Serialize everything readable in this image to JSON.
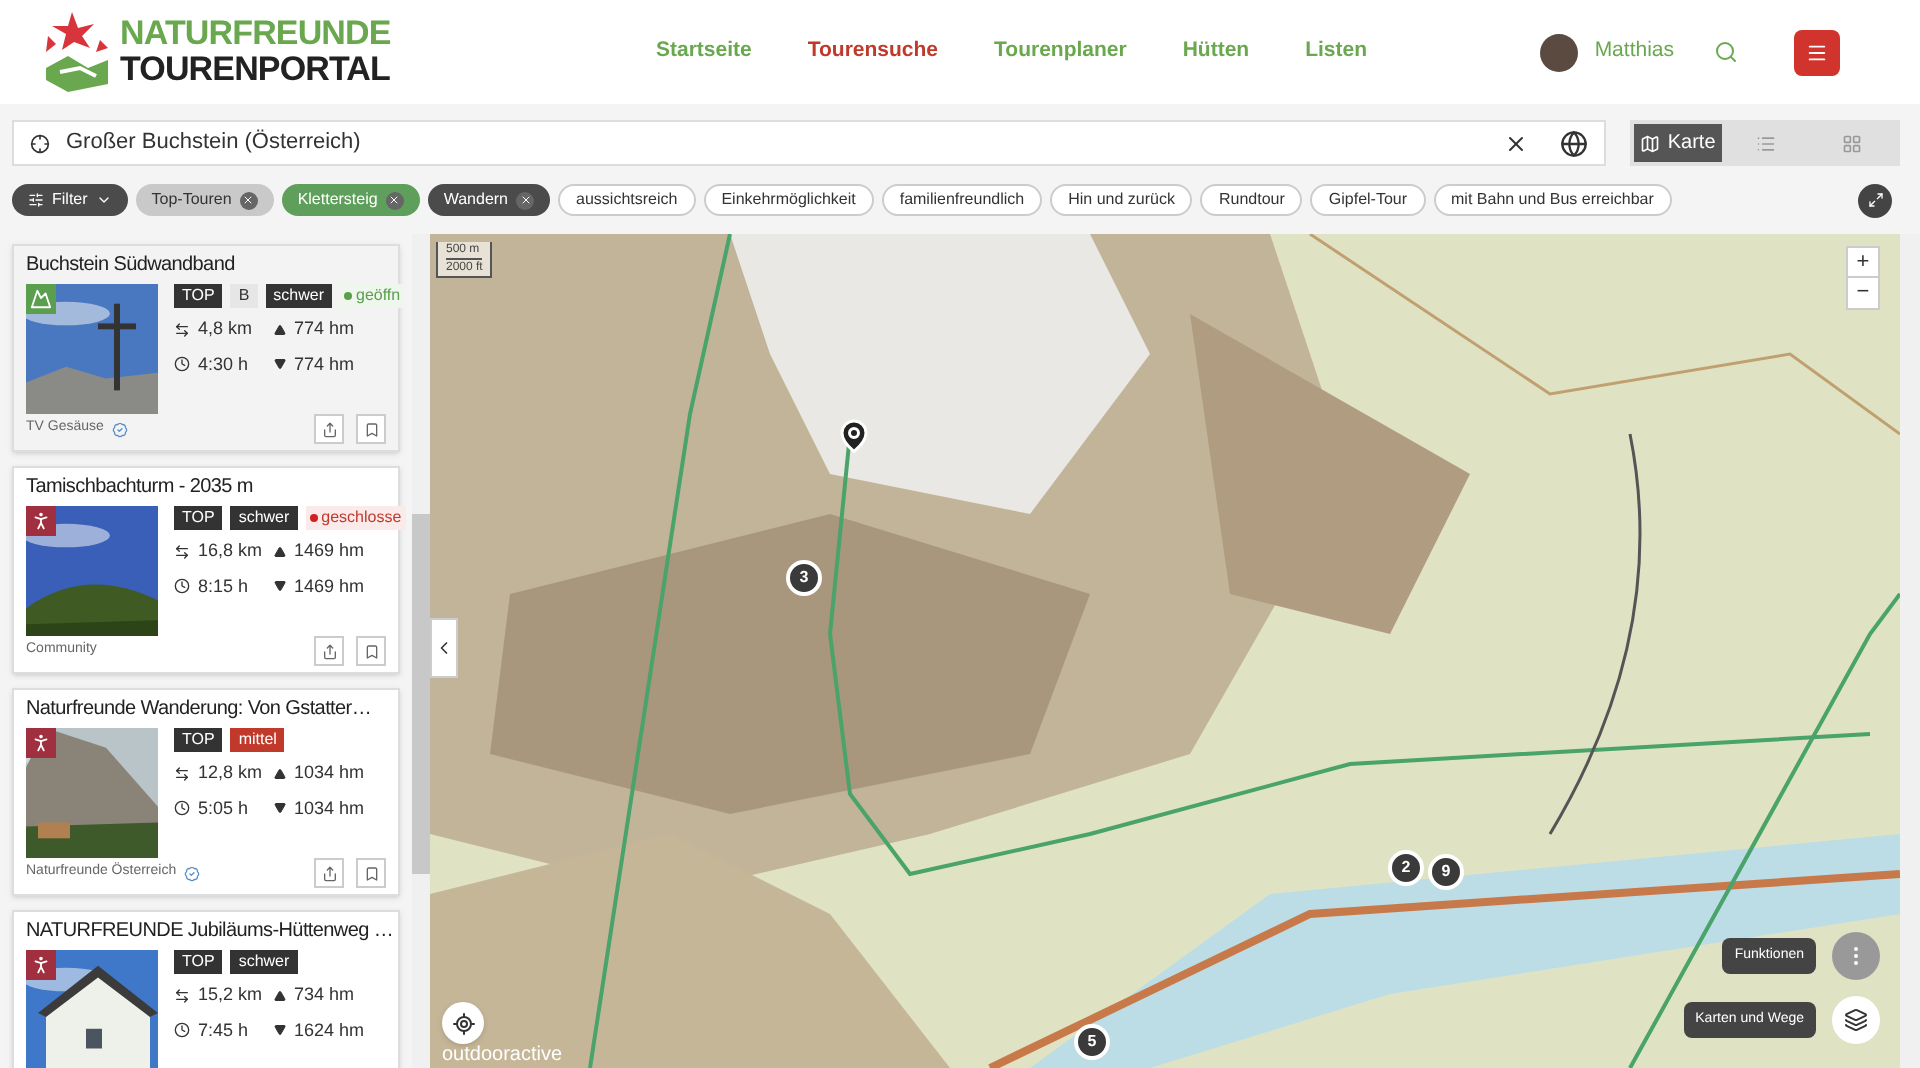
{
  "header": {
    "logo_line_1": "NATURFREUNDE",
    "logo_line_2": "TOURENPORTAL",
    "nav": [
      {
        "label": "Startseite",
        "selected": false
      },
      {
        "label": "Tourensuche",
        "selected": true
      },
      {
        "label": "Tourenplaner",
        "selected": false
      },
      {
        "label": "Hütten",
        "selected": false
      },
      {
        "label": "Listen",
        "selected": false
      }
    ],
    "user": "Matthias"
  },
  "search": {
    "value": "Großer Buchstein (Österreich)"
  },
  "view_toggle": [
    {
      "label": "Karte",
      "kind": "map",
      "selected": true
    },
    {
      "kind": "list",
      "selected": false
    },
    {
      "kind": "grid",
      "selected": false
    }
  ],
  "filters": [
    {
      "label": "Filter",
      "kind": "menu",
      "selected": true,
      "color": "#4b4b4b"
    },
    {
      "label": "Top-Touren",
      "kind": "tag",
      "selected": true,
      "color": "#c9c9c9"
    },
    {
      "label": "Klettersteig",
      "kind": "tag",
      "selected": true,
      "color": "#5f9f5c"
    },
    {
      "label": "Wandern",
      "kind": "tag",
      "selected": true,
      "color": "#4b4b4b"
    },
    {
      "label": "aussichtsreich",
      "kind": "tag",
      "selected": false
    },
    {
      "label": "Einkehrmöglichkeit",
      "kind": "tag",
      "selected": false
    },
    {
      "label": "familienfreundlich",
      "kind": "tag",
      "selected": false
    },
    {
      "label": "Hin und zurück",
      "kind": "tag",
      "selected": false
    },
    {
      "label": "Rundtour",
      "kind": "tag",
      "selected": false
    },
    {
      "label": "Gipfel-Tour",
      "kind": "tag",
      "selected": false
    },
    {
      "label": "mit Bahn und Bus erreichbar",
      "kind": "tag",
      "selected": false
    }
  ],
  "tours": [
    {
      "title": "Buchstein Südwandband",
      "kind": "climbing",
      "selected": true,
      "badges": [
        {
          "text": "TOP",
          "kind": "top"
        },
        {
          "text": "B",
          "kind": "grade"
        },
        {
          "text": "schwer",
          "kind": "hard"
        }
      ],
      "status": {
        "text": "geöffn",
        "kind": "open"
      },
      "distance": "4,8 km",
      "duration": "4:30 h",
      "ascent": "774 hm",
      "descent": "774 hm",
      "source": "TV Gesäuse",
      "verified": true
    },
    {
      "title": "Tamischbachturm - 2035 m",
      "kind": "hiking",
      "selected": false,
      "badges": [
        {
          "text": "TOP",
          "kind": "top"
        },
        {
          "text": "schwer",
          "kind": "hard"
        }
      ],
      "status": {
        "text": "geschlosse",
        "kind": "closed"
      },
      "distance": "16,8 km",
      "duration": "8:15 h",
      "ascent": "1469 hm",
      "descent": "1469 hm",
      "source": "Community",
      "verified": false
    },
    {
      "title": "Naturfreunde Wanderung: Von Gstatter…",
      "kind": "hiking",
      "selected": false,
      "badges": [
        {
          "text": "TOP",
          "kind": "top"
        },
        {
          "text": "mittel",
          "kind": "medium"
        }
      ],
      "distance": "12,8 km",
      "duration": "5:05 h",
      "ascent": "1034 hm",
      "descent": "1034 hm",
      "source": "Naturfreunde Österreich",
      "verified": true
    },
    {
      "title": "NATURFREUNDE Jubiläums-Hüttenweg …",
      "kind": "hiking",
      "selected": false,
      "badges": [
        {
          "text": "TOP",
          "kind": "top"
        },
        {
          "text": "schwer",
          "kind": "hard"
        }
      ],
      "distance": "15,2 km",
      "duration": "7:45 h",
      "ascent": "734 hm",
      "descent": "1624 hm"
    }
  ],
  "map": {
    "scale_metric": "500 m",
    "scale_imperial": "2000 ft",
    "zoom_in": "+",
    "zoom_out": "−",
    "markers": [
      {
        "kind": "pin"
      },
      {
        "kind": "number",
        "label": "3"
      },
      {
        "kind": "number",
        "label": "2"
      },
      {
        "kind": "number",
        "label": "9"
      },
      {
        "kind": "number",
        "label": "5"
      }
    ],
    "functions_label": "Funktionen",
    "layers_label": "Karten und Wege",
    "brand": "outdooractive"
  }
}
